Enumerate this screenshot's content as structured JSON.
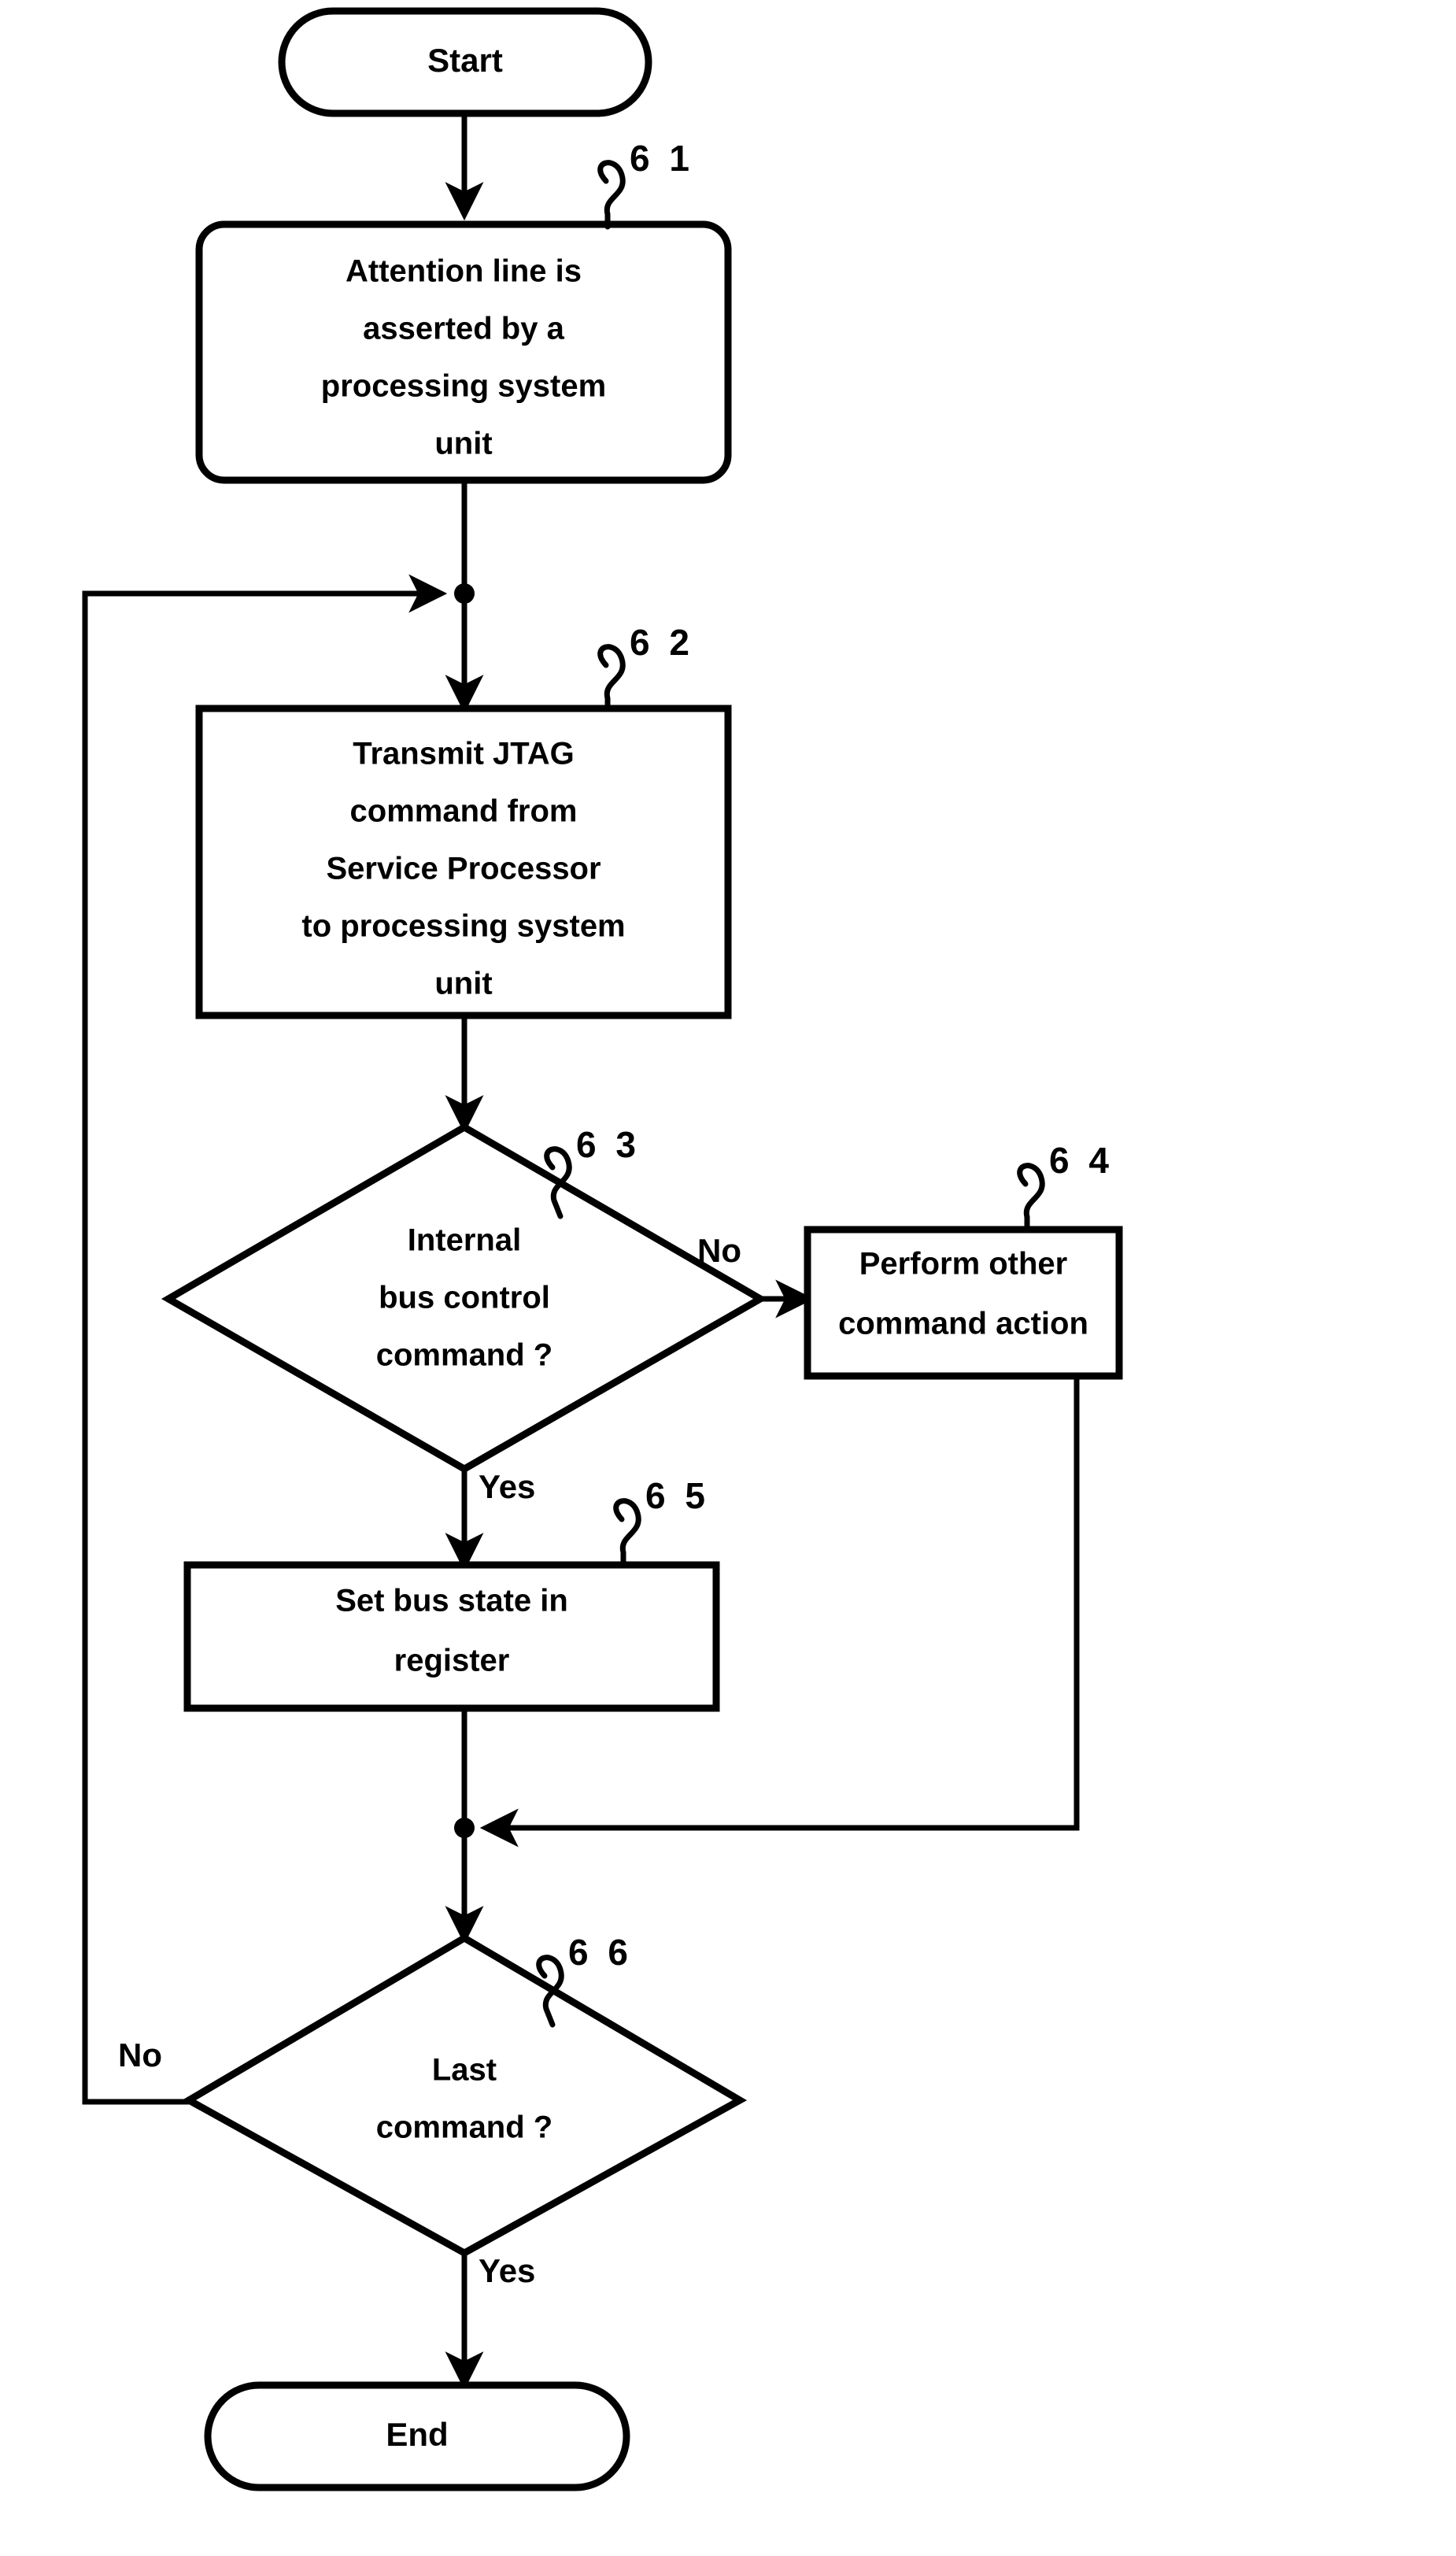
{
  "diagram": {
    "type": "flowchart",
    "title": "JTAG command processing flowchart",
    "background_color": "#ffffff",
    "line_color": "#000000"
  },
  "nodes": {
    "start": {
      "id": "start",
      "shape": "terminator",
      "label": "Start"
    },
    "step61": {
      "id": "61",
      "shape": "rounded-process",
      "ref": "6 1",
      "lines": [
        "Attention line is",
        "asserted by a",
        "processing system",
        "unit"
      ]
    },
    "step62": {
      "id": "62",
      "shape": "process",
      "ref": "6 2",
      "lines": [
        "Transmit JTAG",
        "command from",
        "Service Processor",
        "to processing system",
        "unit"
      ]
    },
    "decision63": {
      "id": "63",
      "shape": "decision",
      "ref": "6 3",
      "lines": [
        "Internal",
        "bus control",
        "command ?"
      ]
    },
    "step64": {
      "id": "64",
      "shape": "process",
      "ref": "6 4",
      "lines": [
        "Perform other",
        "command action"
      ]
    },
    "step65": {
      "id": "65",
      "shape": "process",
      "ref": "6 5",
      "lines": [
        "Set bus state in",
        "register"
      ]
    },
    "decision66": {
      "id": "66",
      "shape": "decision",
      "ref": "6 6",
      "lines": [
        "Last",
        "command ?"
      ]
    },
    "end": {
      "id": "end",
      "shape": "terminator",
      "label": "End"
    }
  },
  "edge_labels": {
    "d63_no": "No",
    "d63_yes": "Yes",
    "d66_no": "No",
    "d66_yes": "Yes"
  }
}
